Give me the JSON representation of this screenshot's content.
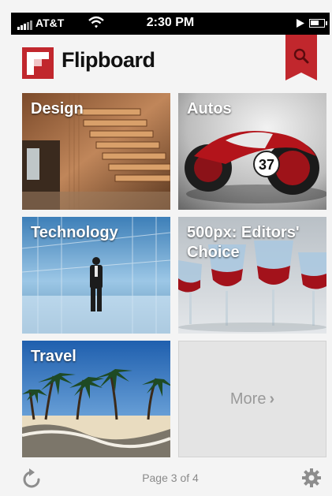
{
  "status_bar": {
    "carrier": "AT&T",
    "time": "2:30 PM"
  },
  "header": {
    "app_title": "Flipboard",
    "brand_color": "#c1272d"
  },
  "tiles": [
    {
      "label": "Design"
    },
    {
      "label": "Autos",
      "badge_number": "37"
    },
    {
      "label": "Technology"
    },
    {
      "label": "500px: Editors' Choice"
    },
    {
      "label": "Travel"
    }
  ],
  "more_tile": {
    "label": "More"
  },
  "footer": {
    "page_indicator": "Page 3 of 4"
  },
  "icons": [
    "wifi-icon",
    "play-icon",
    "battery-icon",
    "logo-icon",
    "search-icon",
    "refresh-icon",
    "settings-icon"
  ]
}
